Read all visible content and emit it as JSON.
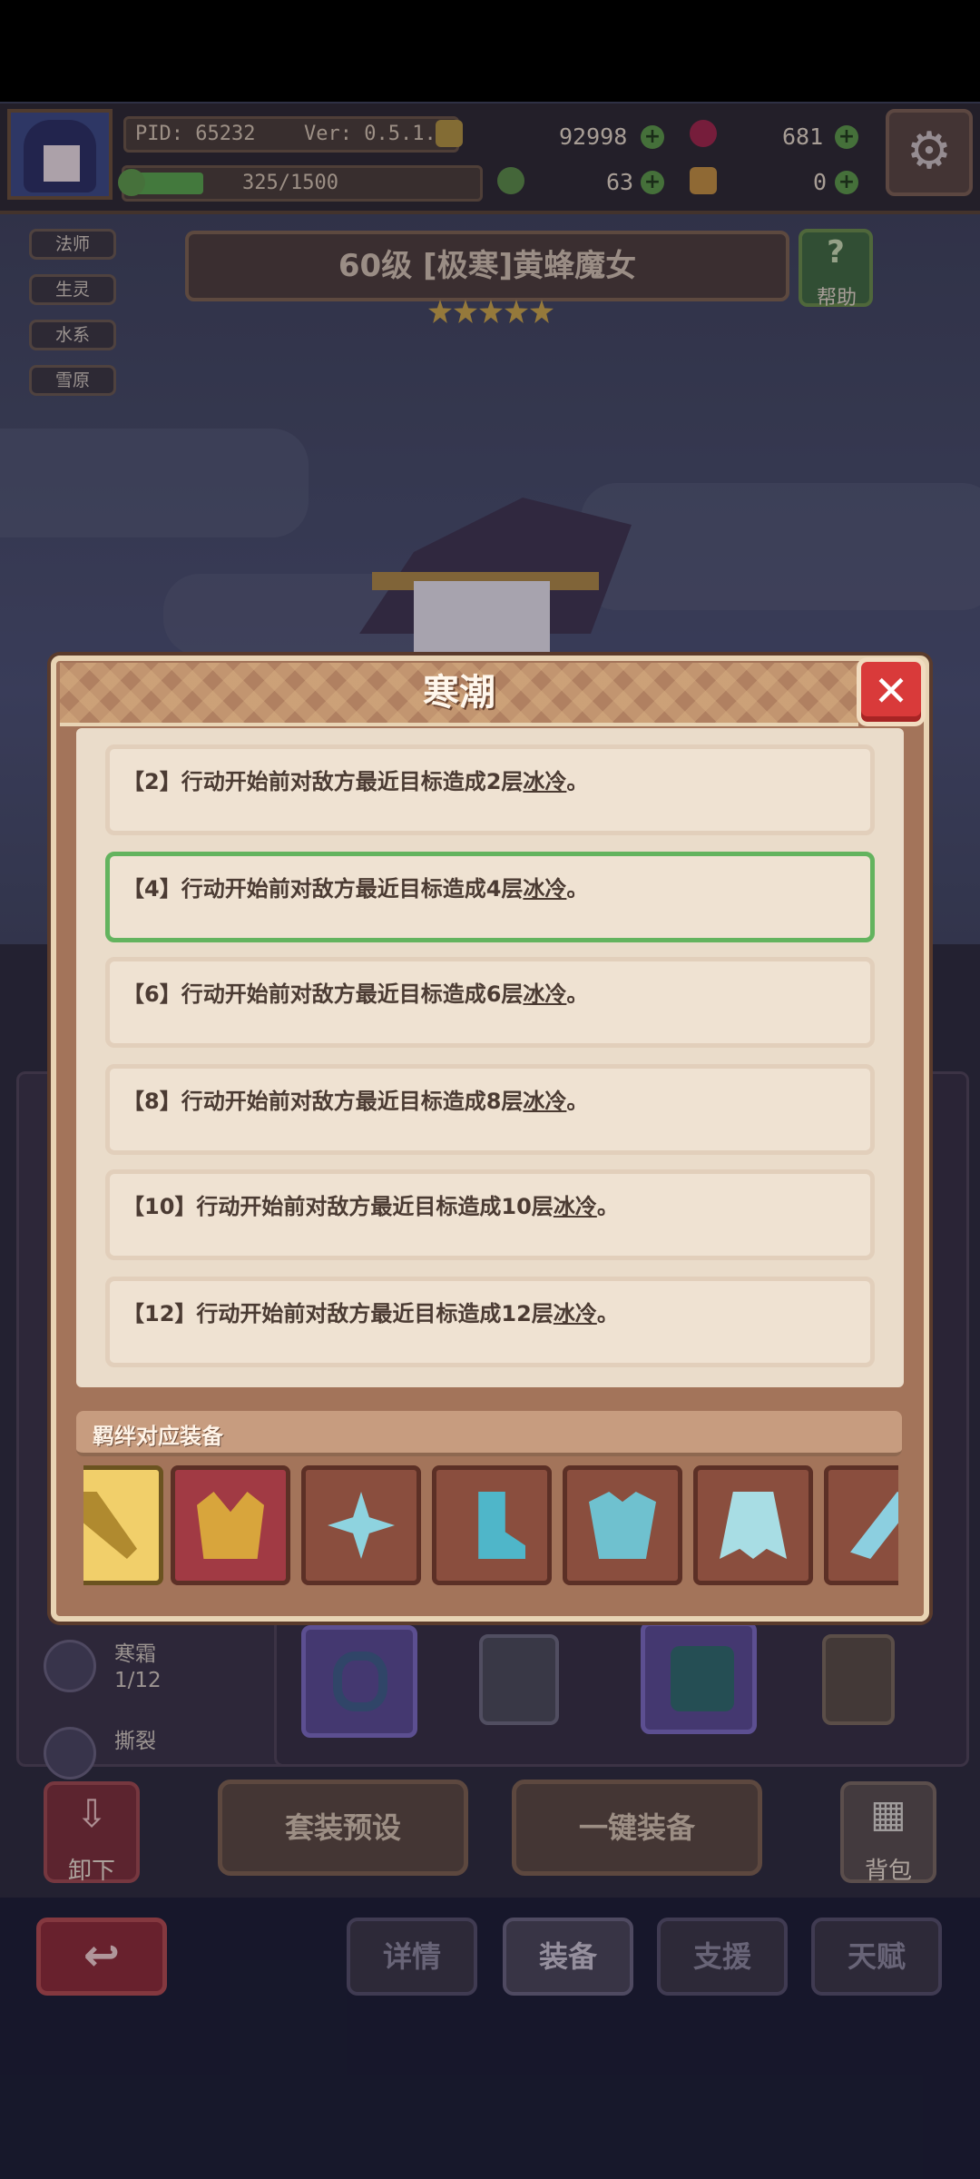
{
  "player": {
    "pid": "PID: 65232",
    "version": "Ver: 0.5.1.2",
    "exp": "325/1500",
    "exp_fraction": 0.217,
    "resources": [
      {
        "icon": "coin-icon",
        "value": "92998"
      },
      {
        "icon": "red-gem-icon",
        "value": "681"
      },
      {
        "icon": "clover-icon",
        "value": "63"
      },
      {
        "icon": "meat-icon",
        "value": "0"
      }
    ]
  },
  "tags": [
    "法师",
    "生灵",
    "水系",
    "雪原"
  ],
  "hero": {
    "title": "60级 [极寒]黄蜂魔女",
    "stars": 5,
    "help_label": "帮助"
  },
  "side_sets": [
    {
      "name": "寒霜",
      "count": "1/12"
    },
    {
      "name": "撕裂",
      "count": ""
    }
  ],
  "buttons": {
    "unequip": "卸下",
    "preset": "套装预设",
    "auto_equip": "一键装备",
    "bag": "背包"
  },
  "tabs": [
    {
      "label": "详情",
      "active": false
    },
    {
      "label": "装备",
      "active": true
    },
    {
      "label": "支援",
      "active": false
    },
    {
      "label": "天赋",
      "active": false
    }
  ],
  "modal": {
    "title": "寒潮",
    "effects": [
      {
        "tier": "【2】",
        "text": "行动开始前对敌方最近目标造成2层",
        "keyword": "冰冷",
        "end": "。",
        "selected": false
      },
      {
        "tier": "【4】",
        "text": "行动开始前对敌方最近目标造成4层",
        "keyword": "冰冷",
        "end": "。",
        "selected": true
      },
      {
        "tier": "【6】",
        "text": "行动开始前对敌方最近目标造成6层",
        "keyword": "冰冷",
        "end": "。",
        "selected": false
      },
      {
        "tier": "【8】",
        "text": "行动开始前对敌方最近目标造成8层",
        "keyword": "冰冷",
        "end": "。",
        "selected": false
      },
      {
        "tier": "【10】",
        "text": "行动开始前对敌方最近目标造成10层",
        "keyword": "冰冷",
        "end": "。",
        "selected": false
      },
      {
        "tier": "【12】",
        "text": "行动开始前对敌方最近目标造成12层",
        "keyword": "冰冷",
        "end": "。",
        "selected": false
      }
    ],
    "bond_label": "羁绊对应装备",
    "equipment": [
      {
        "icon": "golden-staff-icon",
        "bg": "#f1cf6a"
      },
      {
        "icon": "golden-crown-icon",
        "bg": "#a13a44"
      },
      {
        "icon": "ice-crystal-icon",
        "bg": "#8a4e3e"
      },
      {
        "icon": "ice-boots-icon",
        "bg": "#8a4e3e"
      },
      {
        "icon": "ice-armor-icon",
        "bg": "#8a4e3e"
      },
      {
        "icon": "ice-cape-icon",
        "bg": "#8a4e3e"
      },
      {
        "icon": "ice-feather-icon",
        "bg": "#8a4e3e"
      }
    ]
  }
}
